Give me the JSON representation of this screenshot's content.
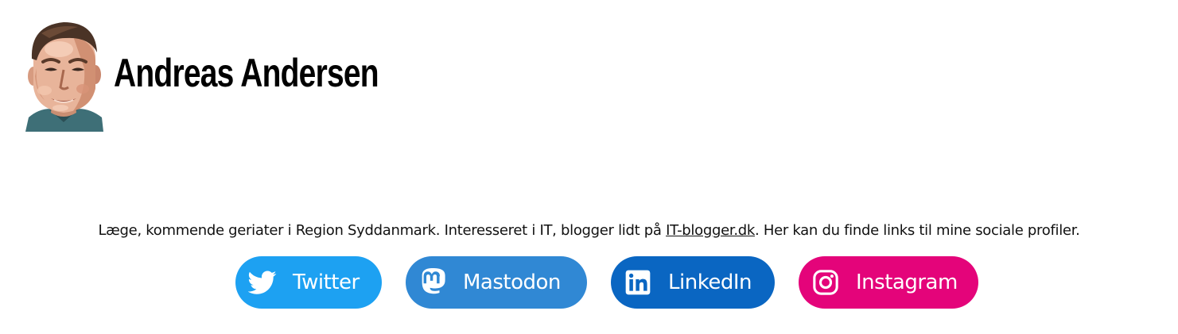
{
  "header": {
    "title": "Andreas Andersen",
    "avatar_alt": "avatar-portrait"
  },
  "bio": {
    "text_before": "Læge, kommende geriater i Region Syddanmark. Interesseret i IT, blogger lidt på ",
    "link_text": "IT-blogger.dk",
    "text_after": ". Her kan du finde links til mine sociale profiler."
  },
  "socials": [
    {
      "label": "Twitter",
      "icon": "twitter-bird-icon",
      "color": "#1da1f2"
    },
    {
      "label": "Mastodon",
      "icon": "mastodon-icon",
      "color": "#3088d4"
    },
    {
      "label": "LinkedIn",
      "icon": "linkedin-icon",
      "color": "#0a66c2"
    },
    {
      "label": "Instagram",
      "icon": "instagram-icon",
      "color": "#e4047a"
    }
  ]
}
